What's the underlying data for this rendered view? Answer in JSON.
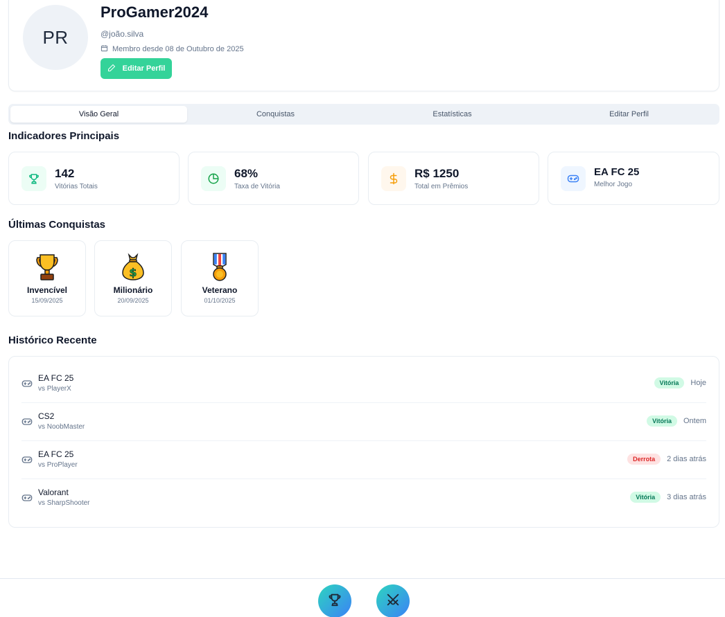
{
  "profile": {
    "initials": "PR",
    "name": "ProGamer2024",
    "handle": "@joão.silva",
    "member_since": "Membro desde 08 de Outubro de 2025",
    "edit_button": "Editar Perfil"
  },
  "tabs": [
    {
      "label": "Visão Geral",
      "active": true
    },
    {
      "label": "Conquistas",
      "active": false
    },
    {
      "label": "Estatísticas",
      "active": false
    },
    {
      "label": "Editar Perfil",
      "active": false
    }
  ],
  "sections": {
    "indicators": "Indicadores Principais",
    "achievements": "Últimas Conquistas",
    "history": "Histórico Recente"
  },
  "stats": [
    {
      "value": "142",
      "label": "Vitórias Totais",
      "icon": "trophy-icon",
      "color": "#10b981",
      "bg": "#ecfdf5"
    },
    {
      "value": "68%",
      "label": "Taxa de Vitória",
      "icon": "pie-chart-icon",
      "color": "#16a34a",
      "bg": "#ecfdf5"
    },
    {
      "value": "R$ 1250",
      "label": "Total em Prêmios",
      "icon": "dollar-icon",
      "color": "#f59e0b",
      "bg": "#fff7ed"
    },
    {
      "value": "EA FC 25",
      "label": "Melhor Jogo",
      "icon": "gamepad-icon",
      "color": "#3b82f6",
      "bg": "#eff6ff"
    }
  ],
  "achievements": [
    {
      "name": "Invencível",
      "date": "15/09/2025",
      "icon": "trophy-emoji"
    },
    {
      "name": "Milionário",
      "date": "20/09/2025",
      "icon": "money-bag-emoji"
    },
    {
      "name": "Veterano",
      "date": "01/10/2025",
      "icon": "military-medal-emoji"
    }
  ],
  "history": [
    {
      "game": "EA FC 25",
      "opponent": "vs PlayerX",
      "result": "Vitória",
      "outcome": "win",
      "when": "Hoje"
    },
    {
      "game": "CS2",
      "opponent": "vs NoobMaster",
      "result": "Vitória",
      "outcome": "win",
      "when": "Ontem"
    },
    {
      "game": "EA FC 25",
      "opponent": "vs ProPlayer",
      "result": "Derrota",
      "outcome": "loss",
      "when": "2 dias atrás"
    },
    {
      "game": "Valorant",
      "opponent": "vs SharpShooter",
      "result": "Vitória",
      "outcome": "win",
      "when": "3 dias atrás"
    }
  ],
  "bottom_nav": [
    {
      "icon": "trophy-icon"
    },
    {
      "icon": "crossed-swords-icon"
    }
  ],
  "colors": {
    "accent_green": "#34d399",
    "win_bg": "#d1fae5",
    "loss_bg": "#fee2e2"
  }
}
